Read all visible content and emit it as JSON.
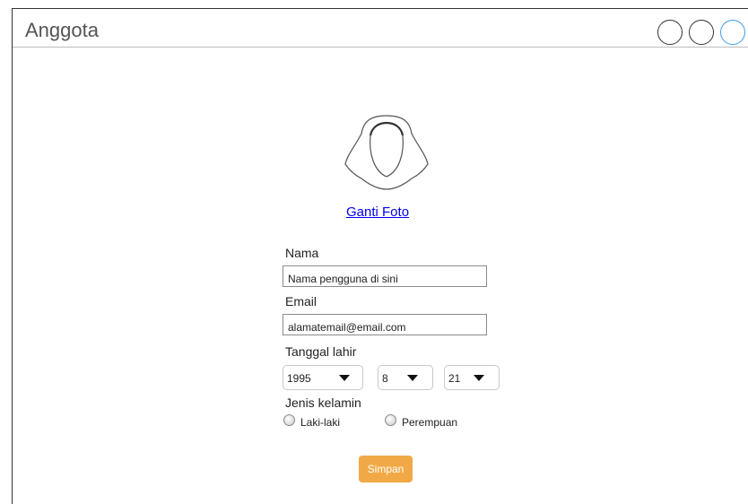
{
  "window": {
    "title": "Anggota"
  },
  "profile": {
    "change_photo_label": "Ganti Foto"
  },
  "form": {
    "name_label": "Nama",
    "name_value": "Nama pengguna di sini",
    "email_label": "Email",
    "email_value": "alamatemail@email.com",
    "birthdate_label": "Tanggal lahir",
    "birth_year": "1995",
    "birth_month": "8",
    "birth_day": "21",
    "gender_label": "Jenis kelamin",
    "gender_options": [
      "Laki-laki",
      "Perempuan"
    ],
    "save_label": "Simpan"
  },
  "colors": {
    "save_button": "#f0a946",
    "link": "#0000ee",
    "maximize_button_border": "#3b9be8"
  }
}
